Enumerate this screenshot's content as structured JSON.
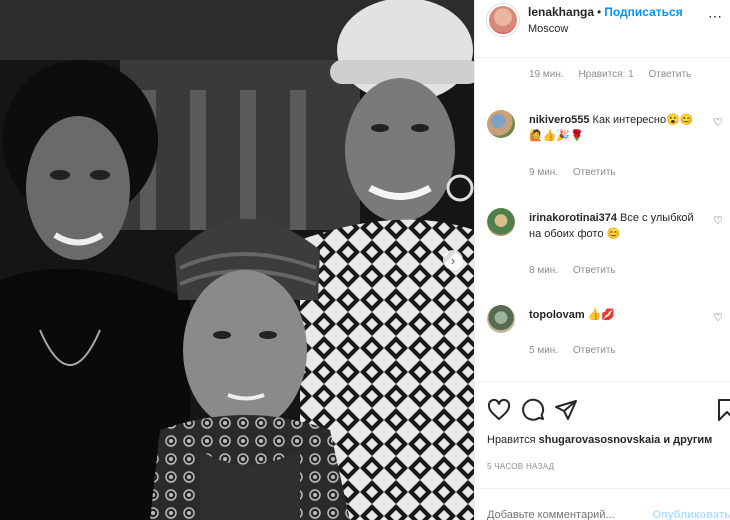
{
  "header": {
    "username": "lenakhanga",
    "separator": "•",
    "follow_label": "Подписаться",
    "location": "Moscow",
    "more_icon": "more-horizontal-icon"
  },
  "top_meta": {
    "time": "19 мин.",
    "likes": "Нравится: 1",
    "reply": "Ответить"
  },
  "comments": [
    {
      "user": "nikivero555",
      "text": "Как интересно😮😊 🙋👍🎉🌹",
      "time": "9 мин.",
      "reply": "Ответить"
    },
    {
      "user": "irinakorotinai374",
      "text": "Все с улыбкой на обоих фото 😊",
      "time": "8 мин.",
      "reply": "Ответить"
    },
    {
      "user": "topolovam",
      "text": "👍💋",
      "time": "5 мин.",
      "reply": "Ответить"
    }
  ],
  "actions": {
    "likes_prefix": "Нравится",
    "liked_by": "shugarovasosnovskaia",
    "likes_suffix": "и другим",
    "posted_time": "5 часов назад"
  },
  "add_comment": {
    "placeholder": "Добавьте комментарий...",
    "post_label": "Опубликовать"
  },
  "photo": {
    "carousel_next_icon": "chevron-right-icon"
  }
}
